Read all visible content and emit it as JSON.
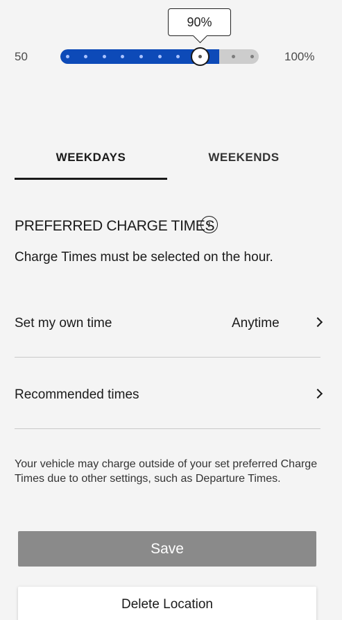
{
  "charge_limit": {
    "min_label": "50",
    "max_label": "100%",
    "min_value": 50,
    "max_value": 100,
    "current_value": 90,
    "current_label": "90%",
    "fill_color": "#0d4ab8"
  },
  "tabs": {
    "weekdays": "WEEKDAYS",
    "weekends": "WEEKENDS",
    "active": "weekdays"
  },
  "preferred": {
    "title": "PREFERRED CHARGE TIMES",
    "info_icon_glyph": "i",
    "description": "Charge Times must be selected on the hour."
  },
  "rows": {
    "own_time": {
      "label": "Set my own time",
      "value": "Anytime"
    },
    "recommended": {
      "label": "Recommended times"
    }
  },
  "note": "Your vehicle may charge outside of your set preferred Charge Times due to other settings, such as Departure Times.",
  "buttons": {
    "save": "Save",
    "delete": "Delete Location"
  }
}
